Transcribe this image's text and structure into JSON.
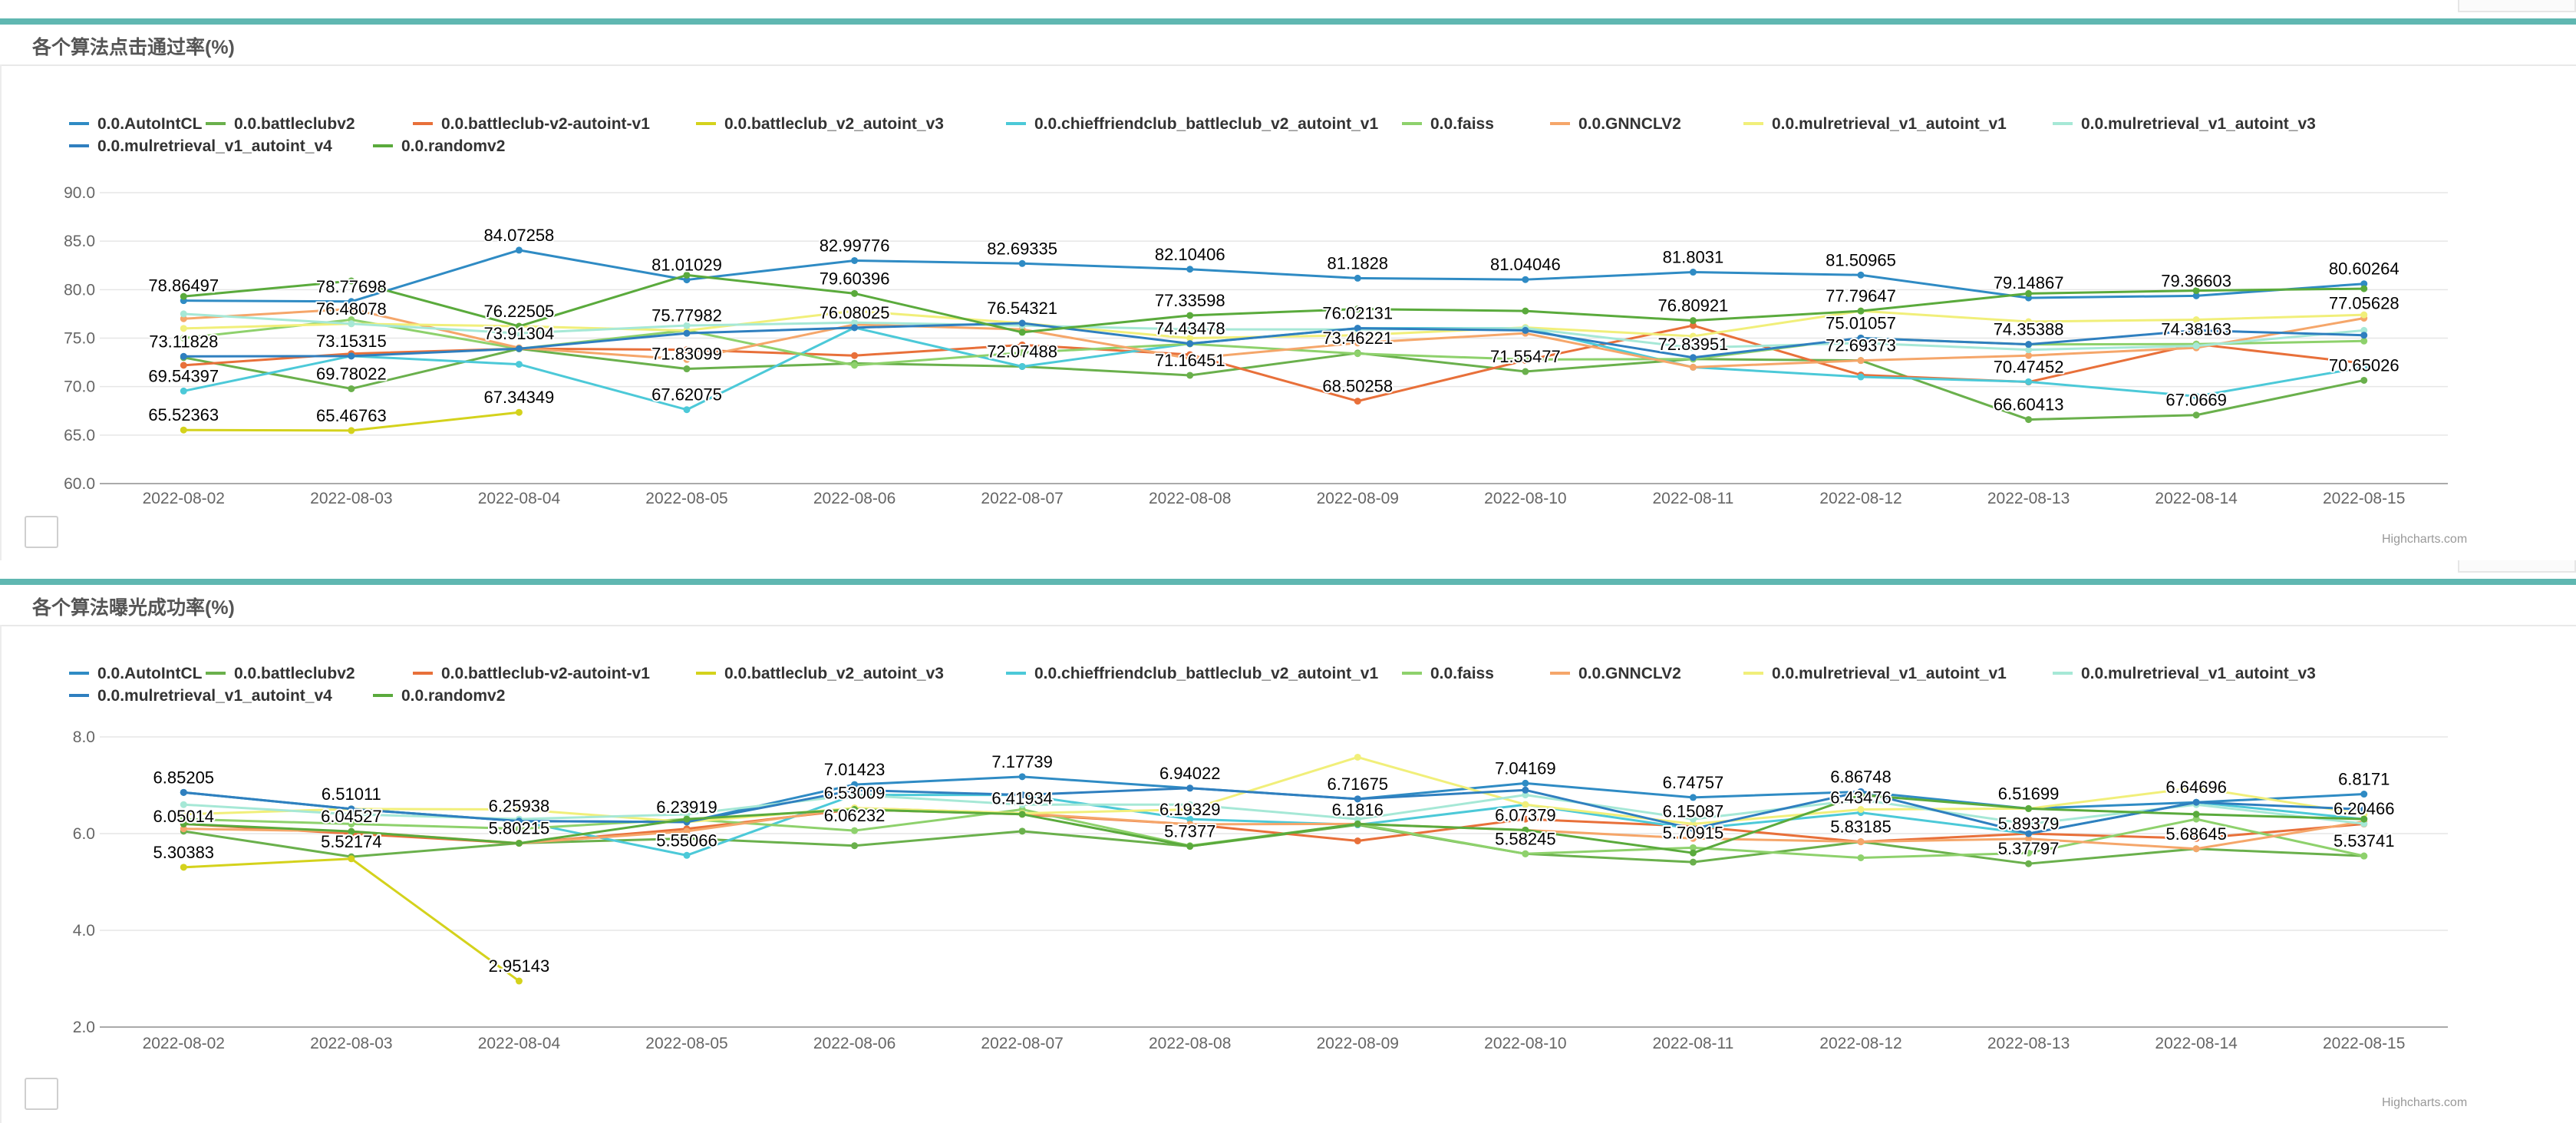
{
  "panels": [
    {
      "title": "各个算法点击通过率(%)",
      "credit": "Highcharts.com"
    },
    {
      "title": "各个算法曝光成功率(%)",
      "credit": "Highcharts.com"
    }
  ],
  "series_colors": {
    "0.0.AutoIntCL": "#2f8bc4",
    "0.0.battleclubv2": "#6ab04c",
    "0.0.battleclub-v2-autoint-v1": "#e8703a",
    "0.0.battleclub_v2_autoint_v3": "#d4d21c",
    "0.0.chieffriendclub_battleclub_v2_autoint_v1": "#4cc9d8",
    "0.0.faiss": "#8ed16c",
    "0.0.GNNCLV2": "#f5a66a",
    "0.0.mulretrieval_v1_autoint_v1": "#f1ef7a",
    "0.0.mulretrieval_v1_autoint_v3": "#a6e8d6",
    "0.0.mulretrieval_v1_autoint_v4": "#2f7fbf",
    "0.0.randomv2": "#5aaa3c"
  },
  "chart_data": [
    {
      "type": "line",
      "title": "各个算法点击通过率(%)",
      "categories": [
        "2022-08-02",
        "2022-08-03",
        "2022-08-04",
        "2022-08-05",
        "2022-08-06",
        "2022-08-07",
        "2022-08-08",
        "2022-08-09",
        "2022-08-10",
        "2022-08-11",
        "2022-08-12",
        "2022-08-13",
        "2022-08-14",
        "2022-08-15"
      ],
      "ylim": [
        60,
        90
      ],
      "yticks": [
        "60.0",
        "65.0",
        "70.0",
        "75.0",
        "80.0",
        "85.0",
        "90.0"
      ],
      "grid": true,
      "legend_position": "top-left",
      "series": [
        {
          "name": "0.0.AutoIntCL",
          "values": [
            78.86497,
            78.77698,
            84.07258,
            81.01029,
            82.99776,
            82.69335,
            82.10406,
            81.1828,
            81.04046,
            81.8031,
            81.50965,
            79.14867,
            79.36603,
            80.60264
          ]
        },
        {
          "name": "0.0.battleclubv2",
          "values": [
            73.0,
            69.78022,
            73.9,
            71.83099,
            72.4,
            72.07488,
            71.16451,
            73.46221,
            71.55477,
            72.83951,
            72.69373,
            66.60413,
            67.0669,
            70.65026
          ]
        },
        {
          "name": "0.0.battleclub-v2-autoint-v1",
          "values": [
            72.2,
            73.4,
            73.91304,
            73.8,
            73.2,
            74.3,
            73.3,
            68.50258,
            72.7,
            76.3,
            71.2,
            70.47452,
            74.38163,
            72.4
          ]
        },
        {
          "name": "0.0.battleclub_v2_autoint_v3",
          "values": [
            65.52363,
            65.46763,
            67.34349
          ]
        },
        {
          "name": "0.0.chieffriendclub_battleclub_v2_autoint_v1",
          "values": [
            69.54397,
            73.15315,
            72.3,
            67.62075,
            76.08025,
            72.07488,
            74.43478,
            76.02131,
            76.02131,
            72.0,
            71.0,
            70.5,
            69.0,
            72.0
          ]
        },
        {
          "name": "0.0.faiss",
          "values": [
            75.0,
            76.9,
            73.9,
            75.8,
            72.2,
            73.5,
            74.4,
            73.4,
            72.8,
            72.83951,
            75.01057,
            74.35388,
            74.38163,
            74.7
          ]
        },
        {
          "name": "0.0.GNNCLV2",
          "values": [
            77.0,
            78.0,
            74.0,
            72.8,
            76.4,
            75.9,
            72.9,
            74.5,
            75.5,
            72.0,
            72.69373,
            73.2,
            74.0,
            77.05628
          ]
        },
        {
          "name": "0.0.mulretrieval_v1_autoint_v1",
          "values": [
            76.0,
            76.48078,
            76.22505,
            75.77982,
            77.8,
            76.54321,
            75.0,
            75.3,
            76.1,
            75.2,
            77.79647,
            76.7,
            76.9,
            77.4
          ]
        },
        {
          "name": "0.0.mulretrieval_v1_autoint_v3",
          "values": [
            77.5,
            76.48078,
            75.5,
            76.3,
            76.6,
            76.3,
            75.9,
            75.9,
            76.02131,
            74.0,
            74.5,
            73.8,
            74.2,
            75.8
          ]
        },
        {
          "name": "0.0.mulretrieval_v1_autoint_v4",
          "values": [
            73.11828,
            73.15315,
            73.91304,
            75.5,
            76.08025,
            76.54321,
            74.43478,
            76.02131,
            75.8,
            73.0,
            75.01057,
            74.35388,
            75.8,
            75.3
          ]
        },
        {
          "name": "0.0.randomv2",
          "values": [
            79.3,
            80.9,
            76.22505,
            81.5,
            79.60396,
            75.6,
            77.33598,
            78.0,
            77.8,
            76.80921,
            77.79647,
            79.6,
            79.9,
            80.1
          ]
        }
      ],
      "data_labels": [
        {
          "series": 0,
          "points": [
            0,
            1,
            2,
            3,
            4,
            5,
            6,
            7,
            8,
            9,
            10,
            11,
            12,
            13
          ]
        },
        {
          "series": 1,
          "points": [
            1,
            3,
            5,
            6,
            7,
            8,
            9,
            10,
            11,
            12,
            13
          ]
        },
        {
          "series": 2,
          "points": [
            2,
            7,
            11,
            12
          ]
        },
        {
          "series": 3,
          "points": [
            0,
            1,
            2
          ]
        },
        {
          "series": 4,
          "points": [
            0,
            3,
            4,
            7
          ]
        },
        {
          "series": 6,
          "points": [
            13
          ]
        },
        {
          "series": 7,
          "points": [
            1,
            2,
            3,
            5,
            10
          ]
        },
        {
          "series": 9,
          "points": [
            0,
            1,
            6,
            10,
            11
          ]
        },
        {
          "series": 10,
          "points": [
            4,
            6,
            9
          ]
        }
      ]
    },
    {
      "type": "line",
      "title": "各个算法曝光成功率(%)",
      "categories": [
        "2022-08-02",
        "2022-08-03",
        "2022-08-04",
        "2022-08-05",
        "2022-08-06",
        "2022-08-07",
        "2022-08-08",
        "2022-08-09",
        "2022-08-10",
        "2022-08-11",
        "2022-08-12",
        "2022-08-13",
        "2022-08-14",
        "2022-08-15"
      ],
      "ylim": [
        2,
        8
      ],
      "yticks": [
        "2.0",
        "4.0",
        "6.0",
        "8.0"
      ],
      "grid": true,
      "legend_position": "top-left",
      "series": [
        {
          "name": "0.0.AutoIntCL",
          "values": [
            6.85205,
            6.51011,
            6.25938,
            6.23919,
            7.01423,
            7.17739,
            6.94022,
            6.71675,
            7.04169,
            6.74757,
            6.86748,
            6.51699,
            6.64696,
            6.8171
          ]
        },
        {
          "name": "0.0.battleclubv2",
          "values": [
            6.05014,
            5.52174,
            5.80215,
            5.9,
            5.75,
            6.05,
            5.7377,
            6.1816,
            5.58245,
            5.41,
            5.83185,
            5.37797,
            5.68645,
            5.53741
          ]
        },
        {
          "name": "0.0.battleclub-v2-autoint-v1",
          "values": [
            6.2,
            6.0,
            5.8,
            6.1,
            6.5,
            6.4,
            6.19329,
            5.85,
            6.3,
            6.15087,
            5.83185,
            6.0,
            5.9,
            6.2
          ]
        },
        {
          "name": "0.0.battleclub_v2_autoint_v3",
          "values": [
            5.30383,
            5.48,
            2.95143
          ]
        },
        {
          "name": "0.0.chieffriendclub_battleclub_v2_autoint_v1",
          "values": [
            6.85205,
            6.51011,
            6.25938,
            5.55066,
            6.8,
            6.8,
            6.3,
            6.1816,
            6.6,
            6.1,
            6.43476,
            6.0,
            6.64696,
            6.3
          ]
        },
        {
          "name": "0.0.faiss",
          "values": [
            6.3,
            6.2,
            6.1,
            6.3,
            6.06232,
            6.5,
            5.75,
            6.2,
            5.58245,
            5.70915,
            5.5,
            5.6,
            6.3,
            5.53741
          ]
        },
        {
          "name": "0.0.GNNCLV2",
          "values": [
            6.1,
            6.04527,
            5.80215,
            6.05,
            6.53009,
            6.41934,
            6.19329,
            6.2,
            6.07379,
            5.9,
            5.83185,
            5.89379,
            5.68645,
            6.25
          ]
        },
        {
          "name": "0.0.mulretrieval_v1_autoint_v1",
          "values": [
            6.4,
            6.51011,
            6.5,
            6.23919,
            6.53009,
            6.41934,
            6.5,
            7.58,
            6.6,
            6.2,
            6.5,
            6.51699,
            6.95,
            6.4
          ]
        },
        {
          "name": "0.0.mulretrieval_v1_autoint_v3",
          "values": [
            6.6,
            6.4,
            6.3,
            6.4,
            6.8,
            6.6,
            6.6,
            6.3,
            6.8,
            6.3,
            6.7,
            6.2,
            6.6,
            6.20466
          ]
        },
        {
          "name": "0.0.mulretrieval_v1_autoint_v4",
          "values": [
            6.85205,
            6.51011,
            6.25938,
            6.23919,
            6.9,
            6.8,
            6.94022,
            6.71675,
            6.9,
            6.1,
            6.86748,
            6.0,
            6.64696,
            6.5
          ]
        },
        {
          "name": "0.0.randomv2",
          "values": [
            6.2,
            6.04527,
            5.8,
            6.3,
            6.5,
            6.4,
            5.7377,
            6.2,
            6.07379,
            5.6,
            6.8,
            6.51699,
            6.4,
            6.3
          ]
        }
      ],
      "data_labels": [
        {
          "series": 0,
          "points": [
            0,
            1,
            2,
            3,
            4,
            5,
            6,
            7,
            8,
            9,
            10,
            11,
            12,
            13
          ]
        },
        {
          "series": 1,
          "points": [
            0,
            1,
            2,
            6,
            7,
            8,
            10,
            11,
            12,
            13
          ]
        },
        {
          "series": 2,
          "points": [
            6,
            9
          ]
        },
        {
          "series": 3,
          "points": [
            0,
            2
          ]
        },
        {
          "series": 4,
          "points": [
            3,
            10
          ]
        },
        {
          "series": 5,
          "points": [
            4,
            9
          ]
        },
        {
          "series": 6,
          "points": [
            1,
            4,
            5,
            8,
            11
          ]
        },
        {
          "series": 8,
          "points": [
            13
          ]
        }
      ]
    }
  ]
}
